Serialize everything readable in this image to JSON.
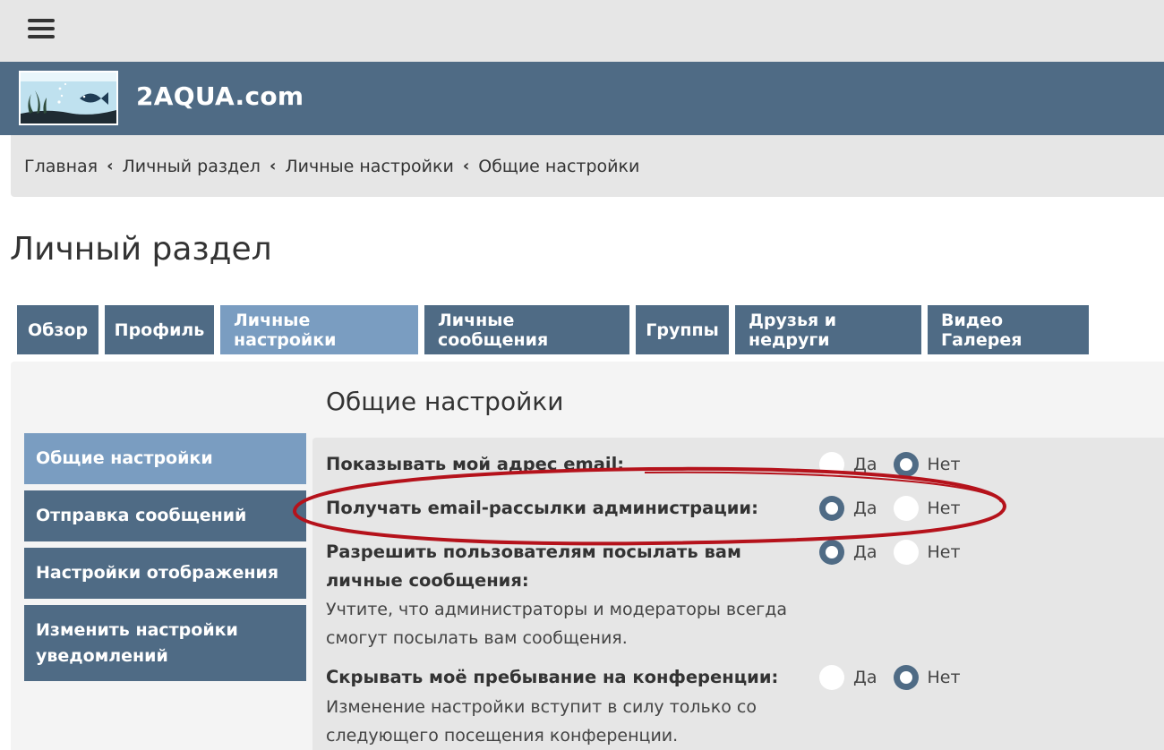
{
  "site": {
    "name": "2AQUA.com",
    "logo_icon": "aquarium-fish-logo"
  },
  "breadcrumb": [
    "Главная",
    "Личный раздел",
    "Личные настройки",
    "Общие настройки"
  ],
  "breadcrumb_separator": "‹",
  "page_title": "Личный раздел",
  "tabs": [
    {
      "label": "Обзор",
      "active": false
    },
    {
      "label": "Профиль",
      "active": false
    },
    {
      "label": "Личные настройки",
      "active": true
    },
    {
      "label": "Личные сообщения",
      "active": false
    },
    {
      "label": "Группы",
      "active": false
    },
    {
      "label": "Друзья и недруги",
      "active": false
    },
    {
      "label": "Видео Галерея",
      "active": false
    }
  ],
  "section_title": "Общие настройки",
  "sidenav": [
    {
      "label": "Общие настройки",
      "active": true
    },
    {
      "label": "Отправка сообщений",
      "active": false
    },
    {
      "label": "Настройки отображения",
      "active": false
    },
    {
      "label": "Изменить настройки уведомлений",
      "active": false
    }
  ],
  "settings": [
    {
      "label": "Показывать мой адрес email:",
      "yes": "Да",
      "no": "Нет",
      "selected": "no"
    },
    {
      "label": "Получать email-рассылки администрации:",
      "yes": "Да",
      "no": "Нет",
      "selected": "yes"
    },
    {
      "label_line1": "Разрешить пользователям посылать вам",
      "label_line2": "личные сообщения:",
      "note_line1": "Учтите, что администраторы и модераторы всегда",
      "note_line2": "смогут посылать вам сообщения.",
      "yes": "Да",
      "no": "Нет",
      "selected": "yes"
    },
    {
      "label": "Скрывать моё пребывание на конференции:",
      "note_line1": "Изменение настройки вступит в силу только со",
      "note_line2": "следующего посещения конференции.",
      "yes": "Да",
      "no": "Нет",
      "selected": "no"
    }
  ],
  "colors": {
    "primary": "#4f6b85",
    "active": "#7a9dc1",
    "annotation": "#b5121b"
  }
}
